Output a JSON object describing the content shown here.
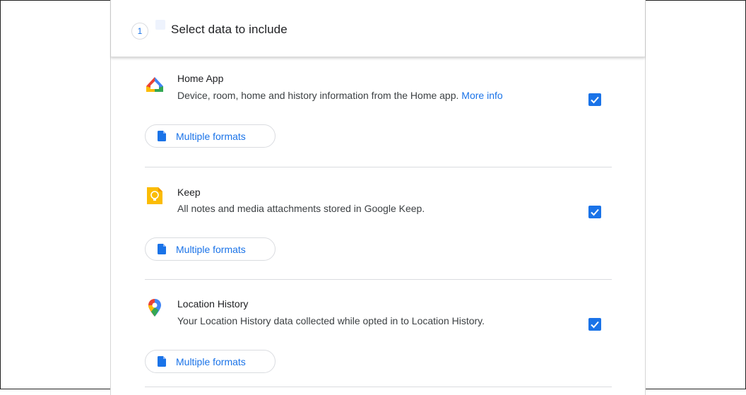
{
  "step": {
    "number": "1",
    "title": "Select data to include"
  },
  "items": [
    {
      "title": "Home App",
      "description": "Device, room, home and history information from the Home app.",
      "link": "More info",
      "checked": true,
      "format_label": "Multiple formats",
      "icon": "home-app-icon"
    },
    {
      "title": "Keep",
      "description": "All notes and media attachments stored in Google Keep.",
      "checked": true,
      "format_label": "Multiple formats",
      "icon": "keep-icon"
    },
    {
      "title": "Location History",
      "description": "Your Location History data collected while opted in to Location History.",
      "checked": true,
      "format_label": "Multiple formats",
      "icon": "location-history-icon"
    }
  ],
  "colors": {
    "accent": "#1a73e8",
    "checkbox": "#1a73e8",
    "divider": "#dadce0"
  }
}
